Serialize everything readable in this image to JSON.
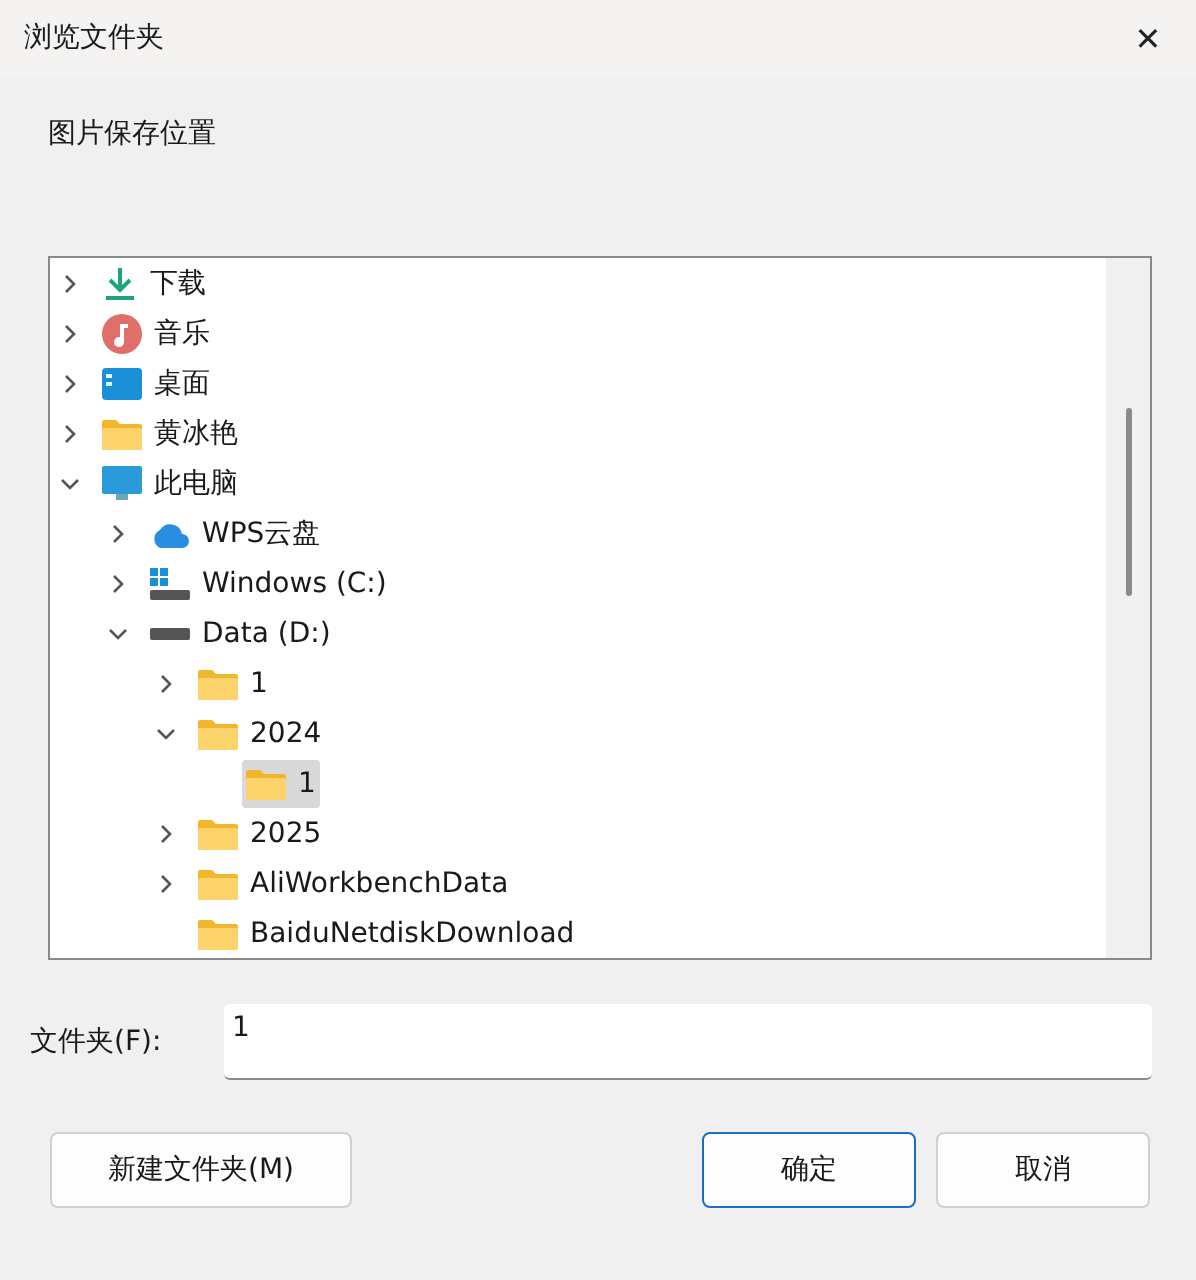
{
  "window": {
    "title": "浏览文件夹",
    "close": "✕"
  },
  "description": "图片保存位置",
  "tree": [
    {
      "label": "下载",
      "kind": "download",
      "expandable": true,
      "expanded": false,
      "selected": false
    },
    {
      "label": "音乐",
      "kind": "music",
      "expandable": true,
      "expanded": false,
      "selected": false
    },
    {
      "label": "桌面",
      "kind": "desktop",
      "expandable": true,
      "expanded": false,
      "selected": false
    },
    {
      "label": "黄冰艳",
      "kind": "folder",
      "expandable": true,
      "expanded": false,
      "selected": false
    },
    {
      "label": "此电脑",
      "kind": "computer",
      "expandable": true,
      "expanded": true,
      "selected": false,
      "children": [
        {
          "label": "WPS云盘",
          "kind": "cloud",
          "expandable": true,
          "expanded": false,
          "selected": false
        },
        {
          "label": "Windows (C:)",
          "kind": "system-drive",
          "expandable": true,
          "expanded": false,
          "selected": false
        },
        {
          "label": "Data (D:)",
          "kind": "drive",
          "expandable": true,
          "expanded": true,
          "selected": false,
          "children": [
            {
              "label": "1",
              "kind": "folder",
              "expandable": true,
              "expanded": false,
              "selected": false
            },
            {
              "label": "2024",
              "kind": "folder",
              "expandable": true,
              "expanded": true,
              "selected": false,
              "children": [
                {
                  "label": "1",
                  "kind": "folder",
                  "expandable": false,
                  "expanded": false,
                  "selected": true
                }
              ]
            },
            {
              "label": "2025",
              "kind": "folder",
              "expandable": true,
              "expanded": false,
              "selected": false
            },
            {
              "label": "AliWorkbenchData",
              "kind": "folder",
              "expandable": true,
              "expanded": false,
              "selected": false
            },
            {
              "label": "BaiduNetdiskDownload",
              "kind": "folder",
              "expandable": false,
              "expanded": false,
              "selected": false
            }
          ]
        }
      ]
    }
  ],
  "folder_field": {
    "label": "文件夹(F):",
    "value": "1"
  },
  "buttons": [
    {
      "label": "新建文件夹(M)",
      "default": false
    },
    {
      "label": "确定",
      "default": true
    },
    {
      "label": "取消",
      "default": false
    }
  ]
}
